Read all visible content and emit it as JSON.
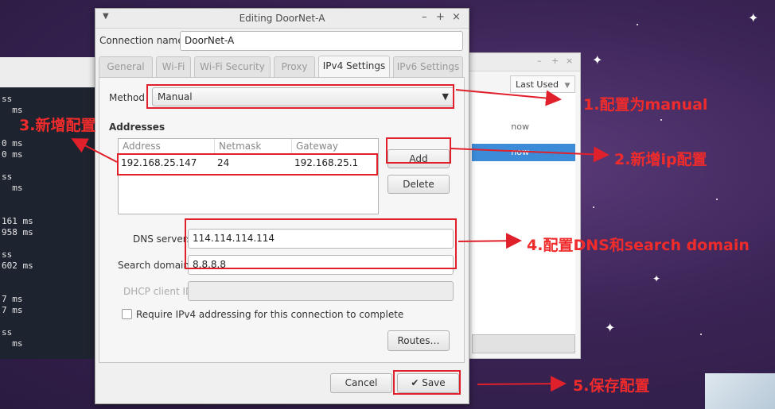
{
  "terminal": {
    "lines": [
      "ss",
      "  ms",
      "",
      "",
      "0 ms",
      "0 ms",
      "",
      "ss",
      "  ms",
      "",
      "",
      "161 ms",
      "958 ms",
      "",
      "ss",
      "602 ms",
      "",
      "",
      "7 ms",
      "7 ms",
      "",
      "ss",
      "  ms"
    ]
  },
  "connections_window": {
    "column_header": "Last Used",
    "rows": [
      "now",
      "now"
    ],
    "selected_row": 1,
    "accent_color": "#3b8bd8"
  },
  "dialog": {
    "title": "Editing DoorNet-A",
    "connection_name_label": "Connection name",
    "connection_name_value": "DoorNet-A",
    "tabs": [
      {
        "label": "General"
      },
      {
        "label": "Wi-Fi"
      },
      {
        "label": "Wi-Fi Security"
      },
      {
        "label": "Proxy"
      },
      {
        "label": "IPv4 Settings"
      },
      {
        "label": "IPv6 Settings"
      }
    ],
    "active_tab": "IPv4 Settings",
    "method_label": "Method",
    "method_value": "Manual",
    "addresses_label": "Addresses",
    "address_columns": [
      "Address",
      "Netmask",
      "Gateway"
    ],
    "address_rows": [
      {
        "address": "192.168.25.147",
        "netmask": "24",
        "gateway": "192.168.25.1"
      }
    ],
    "add_button": "Add",
    "delete_button": "Delete",
    "dns_label": "DNS servers",
    "dns_value": "114.114.114.114",
    "search_label": "Search domains",
    "search_value": "8.8.8.8",
    "dhcp_label": "DHCP client ID",
    "dhcp_value": "",
    "require_checkbox_label": "Require IPv4 addressing for this connection to complete",
    "require_checked": false,
    "routes_button": "Routes…",
    "cancel_button": "Cancel",
    "save_button": "Save"
  },
  "annotations": {
    "a1": "1.配置为manual",
    "a2": "2.新增ip配置",
    "a3": "3.新增配置",
    "a4": "4.配置DNS和search domain",
    "a5": "5.保存配置",
    "color": "#f02b2b"
  },
  "icons": {
    "dropdown": "chevron-down-icon",
    "save": "checkmark-icon",
    "window_menu": "menu-triangle-icon"
  }
}
